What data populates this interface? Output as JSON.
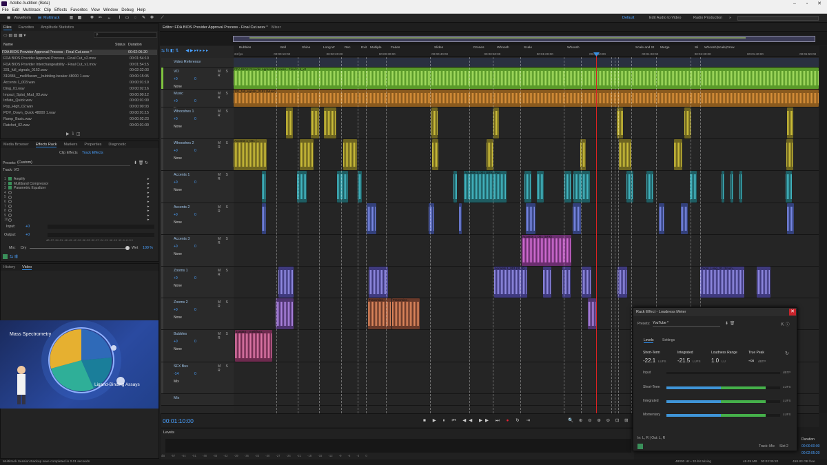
{
  "window": {
    "title": "Adobe Audition (Beta)"
  },
  "menu": [
    "File",
    "Edit",
    "Multitrack",
    "Clip",
    "Effects",
    "Favorites",
    "View",
    "Window",
    "Debug",
    "Help"
  ],
  "toolbar": {
    "waveform": "Waveform",
    "multitrack": "Multitrack",
    "workspaces": [
      "Default",
      "Edit Audio to Video",
      "Radio Production"
    ]
  },
  "files": {
    "tabs": [
      "Files",
      "Favorites",
      "Amplitude Statistics"
    ],
    "col_name": "Name",
    "col_status": "Status",
    "col_duration": "Duration",
    "items": [
      {
        "name": "FDA BIOS Provider Approval Process - Final Cut.sesx *",
        "duration": "00:02:05:20"
      },
      {
        "name": "FDA BIOS Provider Approval Process - Final Cut_v2.mov",
        "duration": "00:01:54:10"
      },
      {
        "name": "FDA BIOS Provider Interchangeability - Final Cut_v1.mov",
        "duration": "00:01:54:15"
      },
      {
        "name": "331_full_signals_0152.wav",
        "duration": "00:02:32:03"
      },
      {
        "name": "319384__mellifluram__bubbling-beaker 48000 1.wav",
        "duration": "00:00:15:05"
      },
      {
        "name": "Accents 1_003.wav",
        "duration": "00:00:01:19"
      },
      {
        "name": "Ding_01.wav",
        "duration": "00:00:02:16"
      },
      {
        "name": "Impact_Splat_Mud_03.wav",
        "duration": "00:00:00:12"
      },
      {
        "name": "Inflate_Quick.wav",
        "duration": "00:00:01:00"
      },
      {
        "name": "Pop_High_02.wav",
        "duration": "00:00:00:03"
      },
      {
        "name": "POV_Down_Quick 48000 1.wav",
        "duration": "00:00:01:15"
      },
      {
        "name": "Ramp_Basic.wav",
        "duration": "00:00:02:23"
      },
      {
        "name": "Ratchet_02.wav",
        "duration": "00:00:01:00"
      }
    ]
  },
  "effects": {
    "tabs": [
      "Media Browser",
      "Effects Rack",
      "Markers",
      "Properties",
      "Diagnostic"
    ],
    "subtabs": [
      "Clip Effects",
      "Track Effects"
    ],
    "presets_label": "Presets:",
    "preset": "(Custom)",
    "track_label": "Track: VO",
    "slots": [
      "Amplify",
      "Multiband Compressor",
      "Parametric Equalizer",
      "",
      "",
      "",
      "",
      "",
      "",
      ""
    ],
    "input": "Input:",
    "output": "Output:",
    "in_val": "+0",
    "out_val": "+0",
    "mix": "Mix:",
    "dry": "Dry",
    "wet": "Wet",
    "wet_pct": "100 %",
    "scale": "dB -57 -54 -51 -48 -45 -42 -39 -36 -33 -30 -27 -24 -21 -18 -15 -12 -9 -6 -3 0"
  },
  "video": {
    "tabs": [
      "History",
      "Video"
    ],
    "title": "Mass Spectrometry",
    "caption": "Ligand-Binding Assays"
  },
  "editor": {
    "tabs": [
      "Editor: FDA BIOS Provider Approval Process - Final Cut.sesx *",
      "Mixer"
    ]
  },
  "ruler": {
    "fps": "24 fps",
    "ticks": [
      "00:00:10:00",
      "00:00:20:00",
      "00:00:30:00",
      "00:00:40:00",
      "00:00:50:00",
      "00:01:00:00",
      "00:01:10:00",
      "00:01:20:00",
      "00:01:30:00",
      "00:01:40:00",
      "00:01:50:00"
    ],
    "markers": [
      "Bubbles",
      "Bell",
      "Shine",
      "Long W",
      "Rec",
      "Exit",
      "Multiple",
      "Fades",
      "Slides",
      "Drones",
      "Whoosh",
      "Scale",
      "Whoosh",
      "Scale and St",
      "Merge",
      "Sli",
      "Whoosh|Scale|Grow"
    ]
  },
  "tracks": [
    {
      "name": "Video Reference",
      "type": "video"
    },
    {
      "name": "VO",
      "vol": "+0",
      "pan": "0",
      "input": "None",
      "color": "#7ec23f"
    },
    {
      "name": "Music",
      "vol": "+0",
      "pan": "0",
      "input": "None",
      "color": "#e08a2a"
    },
    {
      "name": "Whooshes 1",
      "vol": "+0",
      "pan": "0",
      "input": "None",
      "color": "#c8b72a"
    },
    {
      "name": "Whooshes 2",
      "vol": "+0",
      "pan": "0",
      "input": "None",
      "color": "#c8b72a"
    },
    {
      "name": "Accents 1",
      "vol": "+0",
      "pan": "0",
      "input": "None",
      "color": "#34b4c0"
    },
    {
      "name": "Accents 2",
      "vol": "+0",
      "pan": "0",
      "input": "None",
      "color": "#6a7de0"
    },
    {
      "name": "Accents 3",
      "vol": "+0",
      "pan": "0",
      "input": "None",
      "color": "#c04ac0"
    },
    {
      "name": "Zooms 1",
      "vol": "+0",
      "pan": "0",
      "input": "None",
      "color": "#7a72e0"
    },
    {
      "name": "Zooms 2",
      "vol": "+0",
      "pan": "0",
      "input": "None",
      "color": "#a46ad8"
    },
    {
      "name": "Bubbles",
      "vol": "+0",
      "pan": "0",
      "input": "None",
      "color": "#c0407c"
    },
    {
      "name": "SFX Bus",
      "vol": "-14",
      "pan": "0",
      "input": "Mix",
      "color": "#e0a020"
    },
    {
      "name": "Mix",
      "type": "mix"
    }
  ],
  "clips": {
    "vo": "FDA BIOS Provider Approval Process - Final Cut_v2",
    "music": "331_full_signals_0152 (Music)",
    "accents3": "Accents 1_001 (SFX)",
    "zooms1_a": "Accents 1_001 (SFX)",
    "zooms1_b": "Zoom_Long_01 (Zoom...",
    "zooms2_a": "Transmiss...",
    "zooms2_b": "Transmiss...",
    "bubbles": "319384__mellifluro...",
    "accents1": "Accents 1_001 (SFX) Pan",
    "whooshes2": "Accents 1_001 (..."
  },
  "transport": {
    "time": "00:01:10:00"
  },
  "levels": {
    "title": "Levels",
    "scale": "dB -57 -54 -51 -48 -45 -42 -39 -36 -33 -30 -27 -24 -21 -18 -15 -12 -9 -6 -3 0"
  },
  "loudness": {
    "title": "Rack Effect - Loudness Meter",
    "presets_label": "Presets:",
    "preset": "YouTube *",
    "tabs": [
      "Levels",
      "Settings"
    ],
    "short_term_label": "Short-Term",
    "short_term": "-22.1",
    "lufs": "LUFS",
    "integrated_label": "Integrated",
    "integrated": "-21.5",
    "range_label": "Loudness Range",
    "range": "1.0",
    "lu": "LU",
    "truepeak_label": "True Peak",
    "truepeak": "-∞",
    "dbtp": "dBTP",
    "rows": [
      "Input",
      "Short-Term",
      "Integrated",
      "Momentary"
    ],
    "io": "In: L, R | Out: L, R",
    "track": "Track: Mix",
    "slot": "Slot 2",
    "short_fill": 0.87,
    "integrated_fill": 0.87,
    "momentary_fill": 0.87
  },
  "duration": {
    "label": "Duration",
    "start": "00:00:00:00",
    "end": "00:02:05:20"
  },
  "status": {
    "left": "Multitrack Session Backup save completed in 0.01 seconds",
    "rate": "48000 Hz • 32-bit Mixing",
    "mem": "46.09 MB",
    "dur": "00:02:05:20",
    "disk": "458.83 GB free"
  }
}
